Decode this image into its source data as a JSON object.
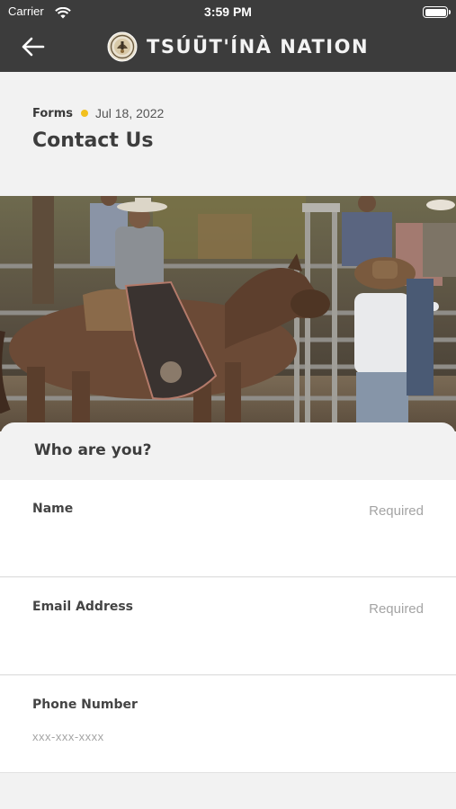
{
  "status_bar": {
    "carrier": "Carrier",
    "time": "3:59 PM"
  },
  "nav": {
    "brand": "TSÚŪT'ÍNÀ NATION"
  },
  "post": {
    "category": "Forms",
    "date": "Jul 18, 2022",
    "title": "Contact Us",
    "dot_color": "#f2c01e"
  },
  "form": {
    "section_title": "Who are you?",
    "fields": [
      {
        "label": "Name",
        "hint": "Required",
        "placeholder": ""
      },
      {
        "label": "Email Address",
        "hint": "Required",
        "placeholder": ""
      },
      {
        "label": "Phone Number",
        "hint": "",
        "placeholder": "xxx-xxx-xxxx"
      }
    ]
  },
  "icons": [
    "back-arrow-icon",
    "wifi-icon",
    "battery-icon",
    "nation-seal-icon"
  ]
}
